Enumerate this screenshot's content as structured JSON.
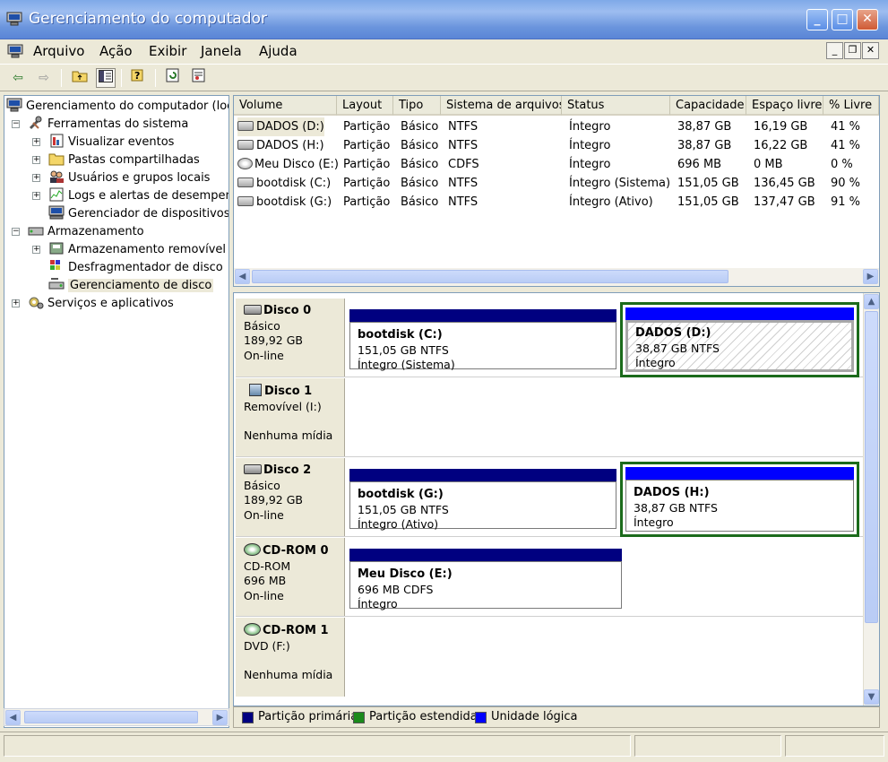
{
  "window": {
    "title": "Gerenciamento do computador"
  },
  "menu": [
    "Arquivo",
    "Ação",
    "Exibir",
    "Janela",
    "Ajuda"
  ],
  "toolbar": {
    "buttons": [
      "back-icon",
      "forward-icon",
      "up-folder-icon",
      "show-hide-tree-icon",
      "help-icon",
      "refresh-icon",
      "properties-icon"
    ]
  },
  "tree": {
    "root": "Gerenciamento do computador (local",
    "items": [
      {
        "label": "Ferramentas do sistema",
        "icon": "tools-icon"
      },
      {
        "label": "Visualizar eventos",
        "icon": "event-viewer-icon"
      },
      {
        "label": "Pastas compartilhadas",
        "icon": "shared-folder-icon"
      },
      {
        "label": "Usuários e grupos locais",
        "icon": "users-icon"
      },
      {
        "label": "Logs e alertas de desempenh",
        "icon": "performance-icon"
      },
      {
        "label": "Gerenciador de dispositivos",
        "icon": "device-manager-icon"
      },
      {
        "label": "Armazenamento",
        "icon": "storage-icon"
      },
      {
        "label": "Armazenamento removível",
        "icon": "removable-storage-icon"
      },
      {
        "label": "Desfragmentador de disco",
        "icon": "defrag-icon"
      },
      {
        "label": "Gerenciamento de disco",
        "icon": "disk-management-icon"
      },
      {
        "label": "Serviços e aplicativos",
        "icon": "services-icon"
      }
    ]
  },
  "volumes": {
    "columns": [
      "Volume",
      "Layout",
      "Tipo",
      "Sistema de arquivos",
      "Status",
      "Capacidade",
      "Espaço livre",
      "% Livre"
    ],
    "rows": [
      [
        "DADOS (D:)",
        "Partição",
        "Básico",
        "NTFS",
        "Íntegro",
        "38,87 GB",
        "16,19 GB",
        "41 %"
      ],
      [
        "DADOS (H:)",
        "Partição",
        "Básico",
        "NTFS",
        "Íntegro",
        "38,87 GB",
        "16,22 GB",
        "41 %"
      ],
      [
        "Meu Disco (E:)",
        "Partição",
        "Básico",
        "CDFS",
        "Íntegro",
        "696 MB",
        "0 MB",
        "0 %"
      ],
      [
        "bootdisk (C:)",
        "Partição",
        "Básico",
        "NTFS",
        "Íntegro (Sistema)",
        "151,05 GB",
        "136,45 GB",
        "90 %"
      ],
      [
        "bootdisk (G:)",
        "Partição",
        "Básico",
        "NTFS",
        "Íntegro (Ativo)",
        "151,05 GB",
        "137,47 GB",
        "91 %"
      ]
    ]
  },
  "disks": [
    {
      "name": "Disco 0",
      "type": "Básico",
      "size": "189,92 GB",
      "status": "On-line",
      "partitions": [
        {
          "name": "bootdisk  (C:)",
          "size": "151,05 GB NTFS",
          "status": "Íntegro (Sistema)"
        },
        {
          "name": "DADOS  (D:)",
          "size": "38,87 GB NTFS",
          "status": "Íntegro"
        }
      ]
    },
    {
      "name": "Disco 1",
      "type": "Removível (I:)",
      "status": "Nenhuma mídia"
    },
    {
      "name": "Disco 2",
      "type": "Básico",
      "size": "189,92 GB",
      "status": "On-line",
      "partitions": [
        {
          "name": "bootdisk  (G:)",
          "size": "151,05 GB NTFS",
          "status": "Íntegro (Ativo)"
        },
        {
          "name": "DADOS  (H:)",
          "size": "38,87 GB NTFS",
          "status": "Íntegro"
        }
      ]
    },
    {
      "name": "CD-ROM 0",
      "type": "CD-ROM",
      "size": "696 MB",
      "status": "On-line",
      "partitions": [
        {
          "name": "Meu Disco  (E:)",
          "size": "696 MB CDFS",
          "status": "Íntegro"
        }
      ]
    },
    {
      "name": "CD-ROM 1",
      "type": "DVD (F:)",
      "status": "Nenhuma mídia"
    }
  ],
  "legend": [
    {
      "label": "Partição primária",
      "color": "#000080"
    },
    {
      "label": "Partição estendida",
      "color": "#1b8a1b"
    },
    {
      "label": "Unidade lógica",
      "color": "#0000ff"
    }
  ]
}
